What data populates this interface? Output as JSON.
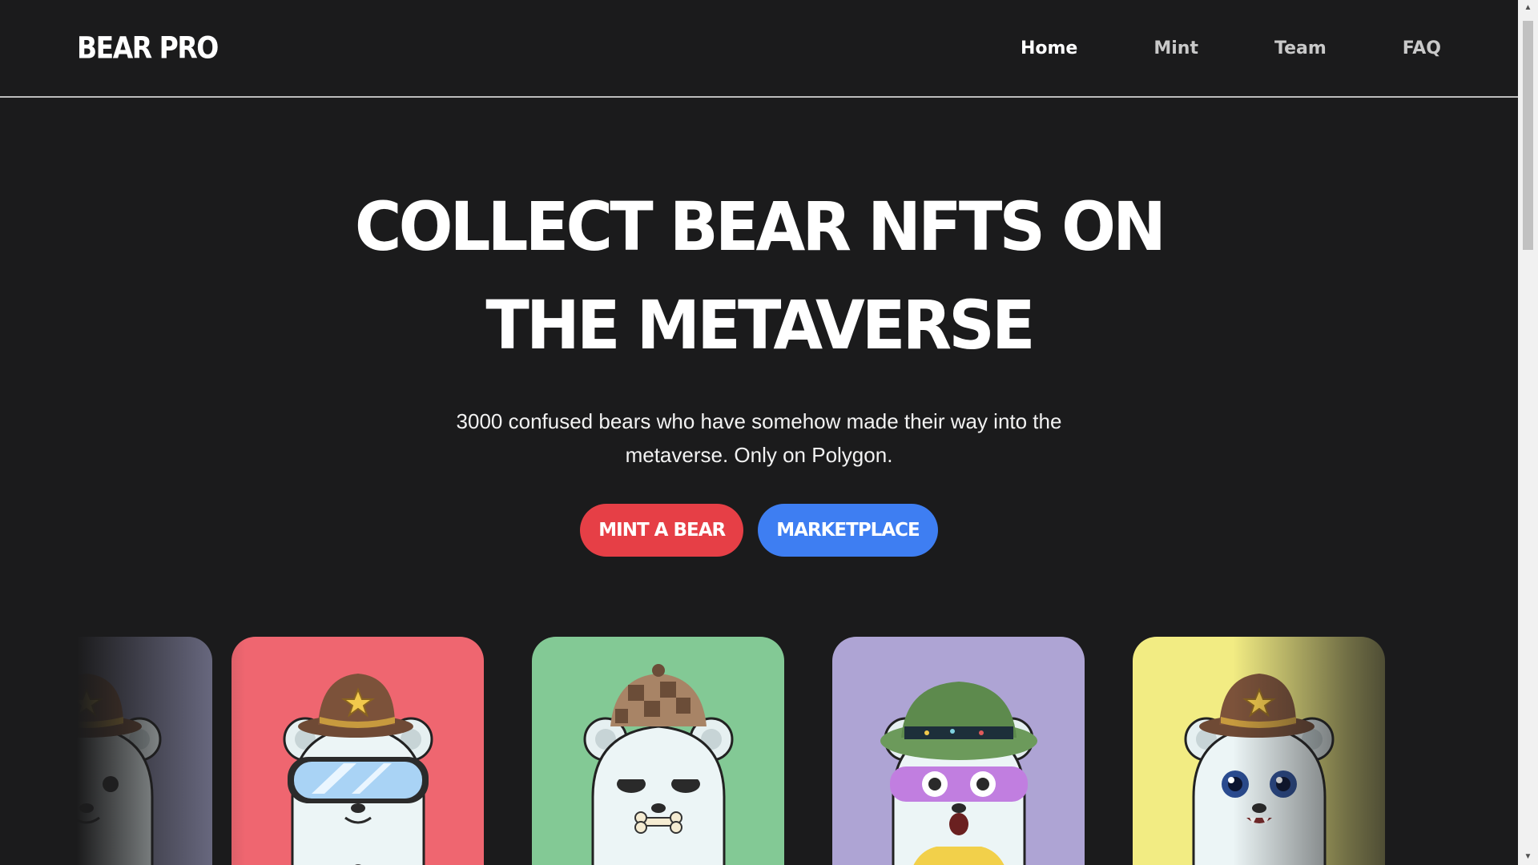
{
  "header": {
    "brand": "BEAR PRO",
    "nav": [
      {
        "label": "Home",
        "active": true
      },
      {
        "label": "Mint",
        "active": false
      },
      {
        "label": "Team",
        "active": false
      },
      {
        "label": "FAQ",
        "active": false
      }
    ]
  },
  "hero": {
    "title_line1": "COLLECT BEAR NFTS ON",
    "title_line2": "THE METAVERSE",
    "subtitle_line1": "3000 confused bears who have somehow made their way into the",
    "subtitle_line2": "metaverse. Only on Polygon.",
    "primary_button": "MINT A BEAR",
    "secondary_button": "MARKETPLACE"
  },
  "colors": {
    "background": "#1b1b1c",
    "primary_button": "#e63f46",
    "secondary_button": "#3e7ef2"
  },
  "carousel": {
    "cards": [
      {
        "name": "bear-card-cowboy-dark",
        "bg": "#7a7a96",
        "hat": "cowboy",
        "eyes": "plain",
        "accessory": "none"
      },
      {
        "name": "bear-card-goggles",
        "bg": "#ef6670",
        "hat": "cowboy",
        "eyes": "goggles",
        "accessory": "overalls"
      },
      {
        "name": "bear-card-detective",
        "bg": "#83c995",
        "hat": "deerstalker",
        "eyes": "squint",
        "accessory": "bone"
      },
      {
        "name": "bear-card-bucket-hat",
        "bg": "#aea4d4",
        "hat": "bucket",
        "eyes": "mask",
        "accessory": "hoodie"
      },
      {
        "name": "bear-card-sheriff",
        "bg": "#f2ec83",
        "hat": "cowboy",
        "eyes": "blue",
        "accessory": "fangs"
      }
    ]
  }
}
